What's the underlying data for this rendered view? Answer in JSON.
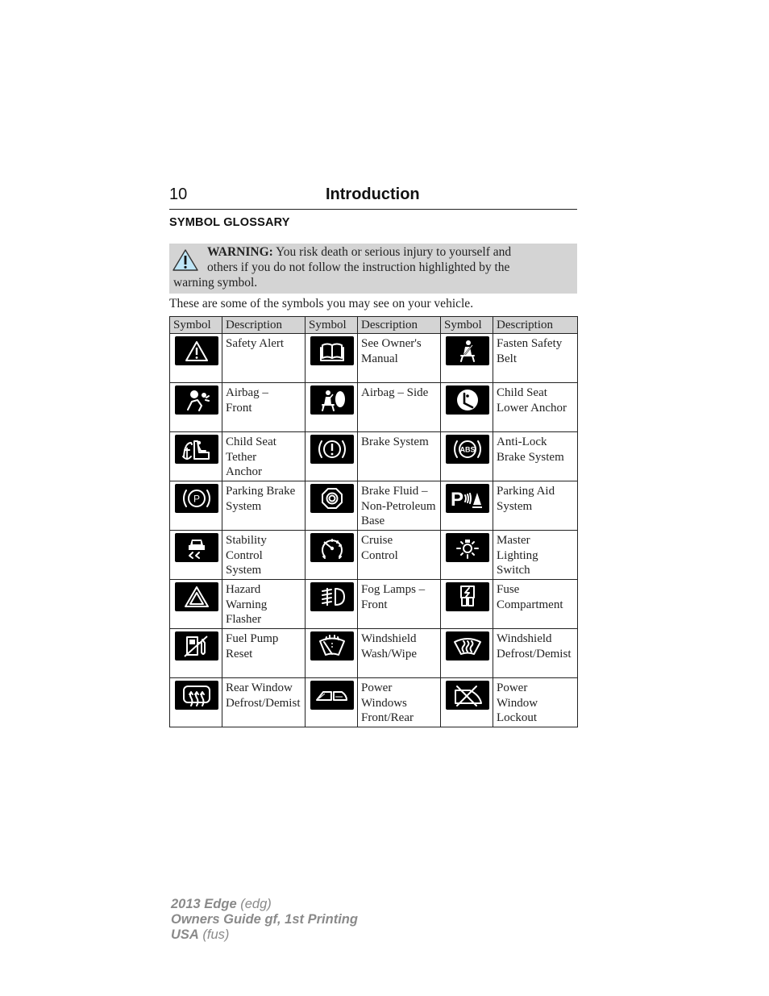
{
  "header": {
    "page_number": "10",
    "chapter_title": "Introduction"
  },
  "section_title": "SYMBOL GLOSSARY",
  "warning": {
    "icon": "warning-triangle-icon",
    "label": "WARNING:",
    "line1": " You risk death or serious injury to yourself and",
    "line2": "others if you do not follow the instruction highlighted by the",
    "line3": "warning symbol.",
    "icon_color": "#bfe6f7"
  },
  "intro_text": "These are some of the symbols you may see on your vehicle.",
  "table": {
    "headers": [
      "Symbol",
      "Description",
      "Symbol",
      "Description",
      "Symbol",
      "Description"
    ],
    "rows": [
      [
        {
          "icon": "safety-alert-icon",
          "lines": [
            "Safety Alert"
          ]
        },
        {
          "icon": "owners-manual-icon",
          "lines": [
            "See Owner's",
            "Manual"
          ]
        },
        {
          "icon": "seat-belt-icon",
          "lines": [
            "Fasten Safety",
            "Belt"
          ]
        }
      ],
      [
        {
          "icon": "airbag-front-icon",
          "lines": [
            "Airbag –",
            "Front"
          ]
        },
        {
          "icon": "airbag-side-icon",
          "lines": [
            "Airbag – Side"
          ]
        },
        {
          "icon": "child-seat-lower-anchor-icon",
          "lines": [
            "Child Seat",
            "Lower Anchor"
          ]
        }
      ],
      [
        {
          "icon": "child-seat-tether-anchor-icon",
          "lines": [
            "Child Seat",
            "Tether",
            "Anchor"
          ]
        },
        {
          "icon": "brake-system-icon",
          "lines": [
            "Brake System"
          ]
        },
        {
          "icon": "abs-icon",
          "lines": [
            "Anti-Lock",
            "Brake System"
          ]
        }
      ],
      [
        {
          "icon": "parking-brake-icon",
          "lines": [
            "Parking Brake",
            "System"
          ]
        },
        {
          "icon": "brake-fluid-icon",
          "lines": [
            "Brake Fluid –",
            "Non-Petroleum",
            "Base"
          ]
        },
        {
          "icon": "parking-aid-icon",
          "lines": [
            "Parking Aid",
            "System"
          ]
        }
      ],
      [
        {
          "icon": "stability-control-icon",
          "lines": [
            "Stability",
            "Control",
            "System"
          ]
        },
        {
          "icon": "cruise-control-icon",
          "lines": [
            "Cruise",
            "Control"
          ]
        },
        {
          "icon": "master-lighting-icon",
          "lines": [
            "Master",
            "Lighting",
            "Switch"
          ]
        }
      ],
      [
        {
          "icon": "hazard-flasher-icon",
          "lines": [
            "Hazard",
            "Warning",
            "Flasher"
          ]
        },
        {
          "icon": "fog-lamps-icon",
          "lines": [
            "Fog Lamps –",
            "Front"
          ]
        },
        {
          "icon": "fuse-icon",
          "lines": [
            "Fuse",
            "Compartment"
          ]
        }
      ],
      [
        {
          "icon": "fuel-pump-reset-icon",
          "lines": [
            "Fuel Pump",
            "Reset"
          ]
        },
        {
          "icon": "windshield-wash-wipe-icon",
          "lines": [
            "Windshield",
            "Wash/Wipe"
          ]
        },
        {
          "icon": "windshield-defrost-icon",
          "lines": [
            "Windshield",
            "Defrost/Demist"
          ]
        }
      ],
      [
        {
          "icon": "rear-window-defrost-icon",
          "lines": [
            "Rear Window",
            "Defrost/Demist"
          ]
        },
        {
          "icon": "power-windows-icon",
          "lines": [
            "Power",
            "Windows",
            "Front/Rear"
          ]
        },
        {
          "icon": "power-window-lockout-icon",
          "lines": [
            "Power",
            "Window",
            "Lockout"
          ]
        }
      ]
    ]
  },
  "footer": {
    "line1_bold": "2013 Edge",
    "line1_light": " (edg)",
    "line2_bold": "Owners Guide gf, 1st Printing",
    "line3_bold": "USA",
    "line3_light": " (fus)"
  }
}
